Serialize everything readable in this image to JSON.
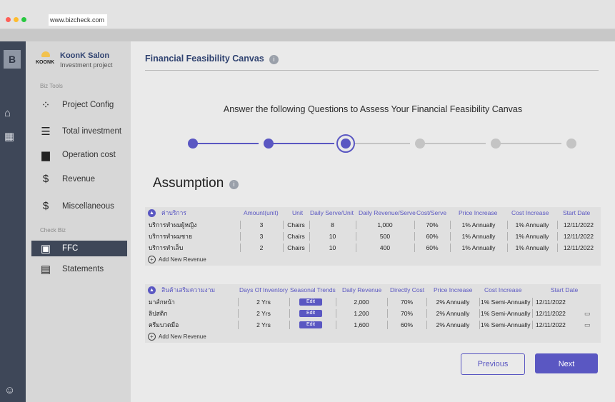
{
  "browser": {
    "url": "www.bizcheck.com",
    "dot_colors": [
      "#ff5f57",
      "#febc2e",
      "#28c840"
    ]
  },
  "rail": {
    "logo": "B",
    "icons": [
      "home-icon",
      "dashboard-icon",
      "user-icon"
    ]
  },
  "brand": {
    "logo_text": "KOONK",
    "name": "KoonK Salon",
    "subtitle": "Investment project"
  },
  "sidebar": {
    "section_tools": "Biz Tools",
    "tools": [
      {
        "label": "Project Config",
        "icon": "config-dots-icon",
        "glyph": "⁘"
      },
      {
        "label": "Total investment",
        "icon": "coins-icon",
        "glyph": "☰"
      },
      {
        "label": "Operation cost",
        "icon": "truck-icon",
        "glyph": "▆"
      },
      {
        "label": "Revenue",
        "icon": "money-bag-icon",
        "glyph": "$"
      },
      {
        "label": "Miscellaneous",
        "icon": "dollar-circle-icon",
        "glyph": "$"
      }
    ],
    "section_check": "Check Biz",
    "check": [
      {
        "label": "FFC",
        "icon": "chart-icon",
        "glyph": "▣",
        "active": true
      },
      {
        "label": "Statements",
        "icon": "statement-icon",
        "glyph": "▤",
        "active": false
      }
    ]
  },
  "main": {
    "title": "Financial Feasibility Canvas",
    "info_glyph": "i",
    "question": "Answer the following Questions to Assess Your Financial Feasibility Canvas",
    "stepper": {
      "total": 6,
      "current": 3
    },
    "section_title": "Assumption"
  },
  "table1": {
    "header": [
      "ค่าบริการ",
      "Amount(unit)",
      "Unit",
      "Daily Serve/Unit",
      "Daily Revenue/Serve",
      "Cost/Serve",
      "Price Increase",
      "Cost Increase",
      "Start Date"
    ],
    "rows": [
      [
        "บริการทำผมผู้หญิง",
        "3",
        "Chairs",
        "8",
        "1,000",
        "70%",
        "1% Annually",
        "1% Annually",
        "12/11/2022"
      ],
      [
        "บริการทำผมชาย",
        "3",
        "Chairs",
        "10",
        "500",
        "60%",
        "1% Annually",
        "1% Annually",
        "12/11/2022"
      ],
      [
        "บริการทำเล็บ",
        "2",
        "Chairs",
        "10",
        "400",
        "60%",
        "1% Annually",
        "1% Annually",
        "12/11/2022"
      ]
    ],
    "add_label": "Add New Revenue"
  },
  "table2": {
    "header": [
      "สินค้าเสริมความงาม",
      "Days Of Inventory",
      "Seasonal Trends",
      "Daily Revenue",
      "Directly Cost",
      "Price Increase",
      "Cost Increase",
      "Start Date"
    ],
    "rows": [
      [
        "มาส์กหน้า",
        "2 Yrs",
        "Edit",
        "2,000",
        "70%",
        "2% Annually",
        "1% Semi-Annually",
        "12/11/2022"
      ],
      [
        "ลิปสติก",
        "2 Yrs",
        "Edit",
        "1,200",
        "70%",
        "2% Annually",
        "1% Semi-Annually",
        "12/11/2022"
      ],
      [
        "ครีมบวดมือ",
        "2 Yrs",
        "Edit",
        "1,600",
        "60%",
        "2% Annually",
        "1% Semi-Annually",
        "12/11/2022"
      ]
    ],
    "add_label": "Add New Revenue"
  },
  "buttons": {
    "previous": "Previous",
    "next": "Next"
  },
  "colors": {
    "accent": "#5a57c2",
    "step_done": "#5a57c2",
    "step_todo": "#c4c4c4",
    "rail": "#3e4758"
  }
}
